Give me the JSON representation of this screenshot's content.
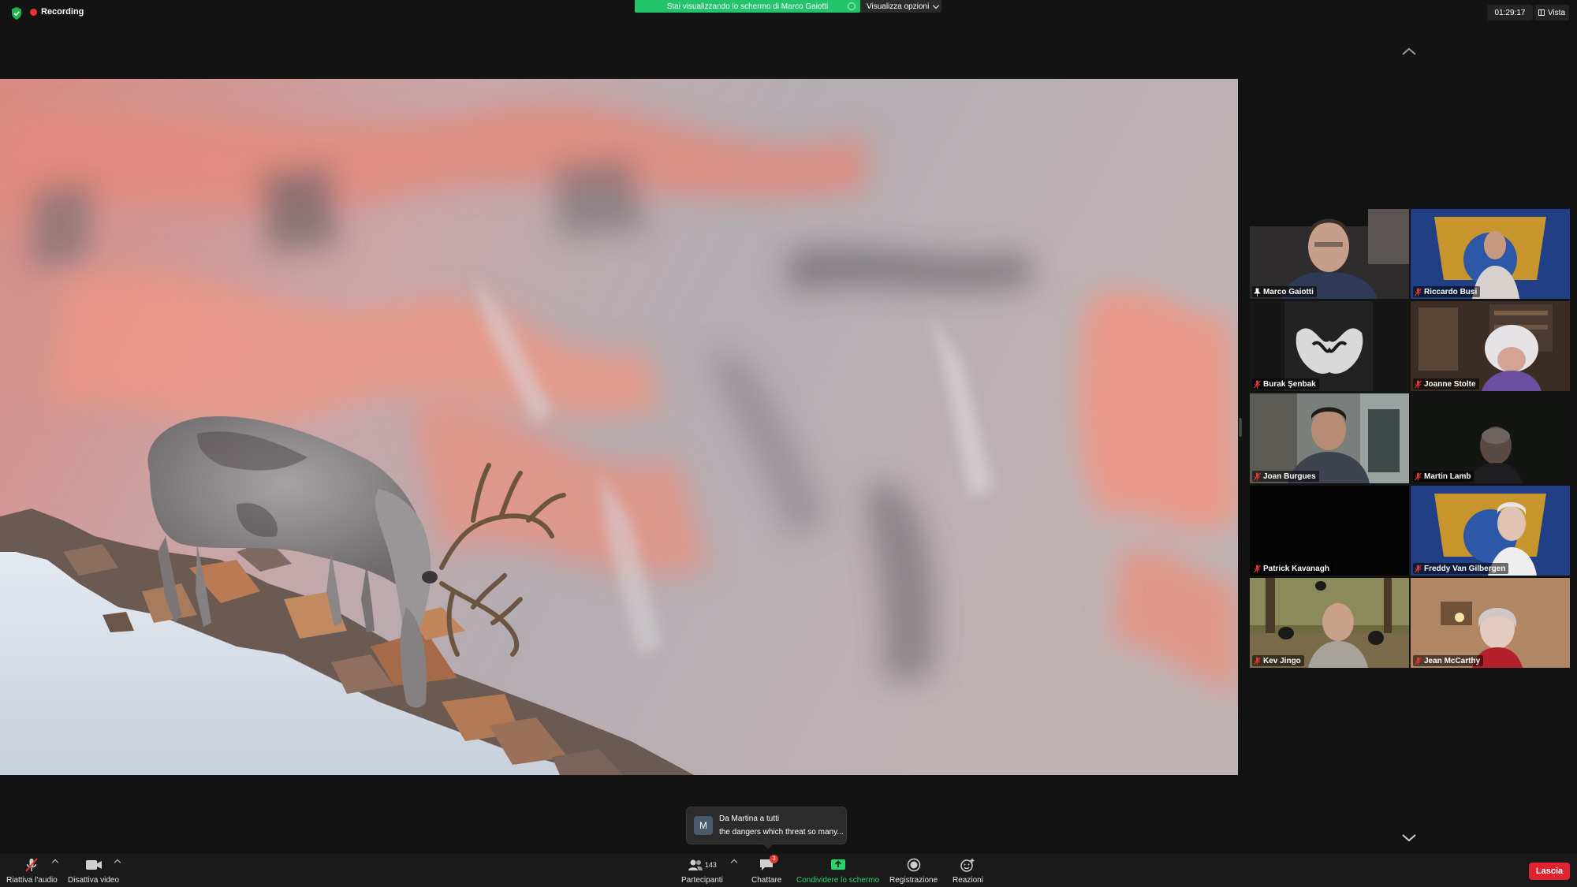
{
  "top_bar": {
    "recording_label": "Recording",
    "share_banner": "Stai visualizzando lo schermo di Marco Gaiotti",
    "view_options": "Visualizza opzioni",
    "timer": "01:29:17",
    "view_button": "Vista"
  },
  "gallery": {
    "participants": [
      {
        "name": "Marco Gaiotti",
        "active_speaker": true
      },
      {
        "name": "Riccardo Busi"
      },
      {
        "name": "Burak Şenbak"
      },
      {
        "name": "Joanne Stolte"
      },
      {
        "name": "Joan Burgues"
      },
      {
        "name": "Martin Lamb"
      },
      {
        "name": "Patrick Kavanagh"
      },
      {
        "name": "Freddy Van Gilbergen"
      },
      {
        "name": "Kev Jingo"
      },
      {
        "name": "Jean McCarthy"
      }
    ]
  },
  "chat_toast": {
    "avatar_initial": "M",
    "from": "Da Martina a tutti",
    "message": "the dangers which threat so many..."
  },
  "toolbar": {
    "unmute_label": "Riattiva l'audio",
    "video_label": "Disattiva video",
    "participants_label": "Partecipanti",
    "participants_count": "143",
    "chat_label": "Chattare",
    "chat_badge": "3",
    "share_label": "Condividere lo schermo",
    "record_label": "Registrazione",
    "reactions_label": "Reazioni",
    "leave_label": "Lascia"
  },
  "colors": {
    "share_banner_green": "#22c36a",
    "active_speaker_border": "#e9e97a",
    "leave_red": "#e0242f",
    "share_label_green": "#2bd36a"
  }
}
